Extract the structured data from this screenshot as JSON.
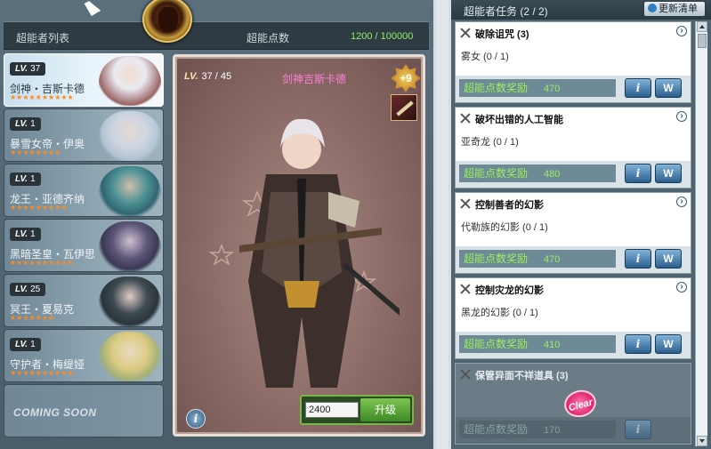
{
  "left_header": {
    "list_title": "超能者列表",
    "points_title": "超能点数",
    "points_value": "1200 / 100000"
  },
  "heroes": [
    {
      "lv_label": "LV.",
      "lv": "37",
      "name": "剑神・吉斯卡德",
      "stars": "★★★★★★★★★★",
      "selected": true
    },
    {
      "lv_label": "LV.",
      "lv": "1",
      "name": "暴雪女帝・伊奥",
      "stars": "★★★★★★★★"
    },
    {
      "lv_label": "LV.",
      "lv": "1",
      "name": "龙王・亚德齐纳",
      "stars": "★★★★★★★★★"
    },
    {
      "lv_label": "LV.",
      "lv": "1",
      "name": "黑暗圣皇・瓦伊思",
      "stars": "★★★★★★★★★★"
    },
    {
      "lv_label": "LV.",
      "lv": "25",
      "name": "冥王・夏易克",
      "stars": "★★★★★★★"
    },
    {
      "lv_label": "LV.",
      "lv": "1",
      "name": "守护者・梅缇娅",
      "stars": "★★★★★★★★★★"
    }
  ],
  "coming_soon": "COMING SOON",
  "detail": {
    "lv_label": "LV.",
    "level": "37 / 45",
    "name": "剑神吉斯卡德",
    "plus": "+9",
    "upgrade_value": "2400",
    "upgrade_label": "升级",
    "info_glyph": "i"
  },
  "missions_header": {
    "title": "超能者任务 (2 / 2)",
    "refresh_label": "更新清单"
  },
  "missions": [
    {
      "title": "破除诅咒 (3)",
      "target": "雾女  (0 / 1)",
      "reward_label": "超能点数奖励",
      "reward": "470"
    },
    {
      "title": "破坏出错的人工智能",
      "target": "亚奇龙  (0 / 1)",
      "reward_label": "超能点数奖励",
      "reward": "480"
    },
    {
      "title": "控制善者的幻影",
      "target": "代勒族的幻影  (0 / 1)",
      "reward_label": "超能点数奖励",
      "reward": "470"
    },
    {
      "title": "控制灾龙的幻影",
      "target": "黑龙的幻影  (0 / 1)",
      "reward_label": "超能点数奖励",
      "reward": "410"
    },
    {
      "title": "保管异面不祥道具  (3)",
      "target": "",
      "reward_label": "超能点数奖励",
      "reward": "170",
      "locked": true,
      "stamp": "Clear"
    }
  ],
  "icons": {
    "info": "i",
    "w": "W",
    "arrow": "›"
  },
  "colors": {
    "reward_text": "#9bf05f",
    "detail_name": "#ff7ed7",
    "points_value": "#8ef06a",
    "stars": "#ff8a1e"
  }
}
